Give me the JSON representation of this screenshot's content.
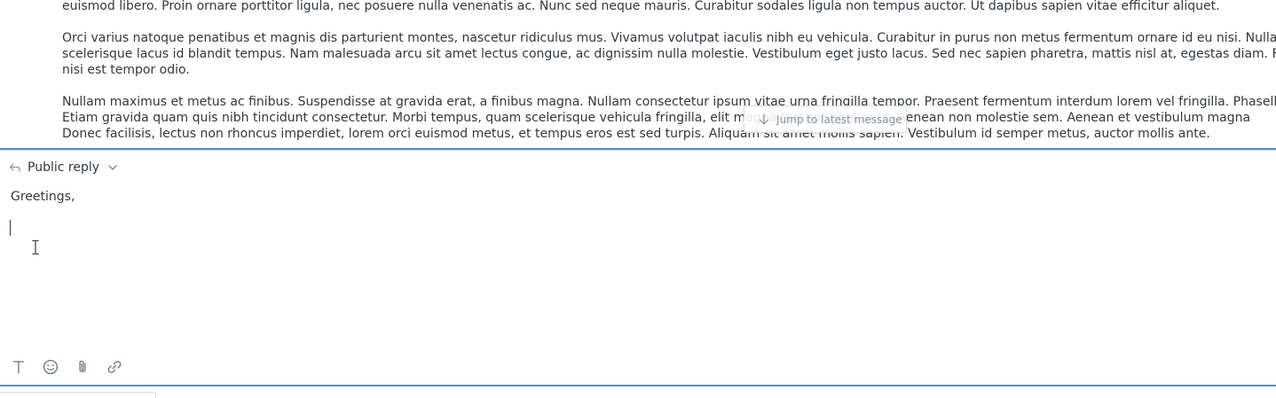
{
  "conversation": {
    "paragraphs": [
      {
        "lines": [
          "euismod libero. Proin ornare porttitor ligula, nec posuere nulla venenatis ac. Nunc sed neque mauris. Curabitur sodales ligula non tempus auctor. Ut dapibus sapien vitae efficitur aliquet."
        ]
      },
      {
        "lines": [
          "Orci varius natoque penatibus et magnis dis parturient montes, nascetur ridiculus mus. Vivamus volutpat iaculis nibh eu vehicula. Curabitur in purus non metus fermentum ornare id eu nisi. Nulla vel maximus tortor. Aenean",
          "scelerisque lacus id blandit tempus. Nam malesuada arcu sit amet lectus congue, ac dignissim nulla molestie. Vestibulum eget justo lacus. Sed nec sapien pharetra, mattis nisl at, egestas diam. Fusce vehicula, quam ut ultrices",
          "nisi est tempor odio."
        ]
      },
      {
        "lines": [
          "Nullam maximus et metus ac finibus. Suspendisse at gravida erat, a finibus magna. Nullam consectetur ipsum vitae urna fringilla tempor. Praesent fermentum interdum lorem vel fringilla. Phasellus a ex urna. Pellentesque",
          "Etiam gravida quam quis nibh tincidunt consectetur. Morbi tempus, quam scelerisque vehicula fringilla, elit magna tempor                              eget ante. Aenean non molestie sem. Aenean et vestibulum magna",
          "Donec facilisis, lectus non rhoncus imperdiet, lorem orci euismod metus, et tempus eros est sed turpis. Aliquam sit amet mollis sapien. Vestibulum id semper metus, auctor mollis ante."
        ]
      }
    ],
    "jump_button_label": "Jump to latest message"
  },
  "composer": {
    "reply_type_label": "Public reply",
    "body_text": "Greetings,"
  },
  "toolbar": {
    "icons": [
      "text-format-icon",
      "emoji-icon",
      "attachment-icon",
      "link-icon"
    ]
  },
  "colors": {
    "divider": "#5c8fc9",
    "text": "#2f3941",
    "muted": "#87929d"
  }
}
